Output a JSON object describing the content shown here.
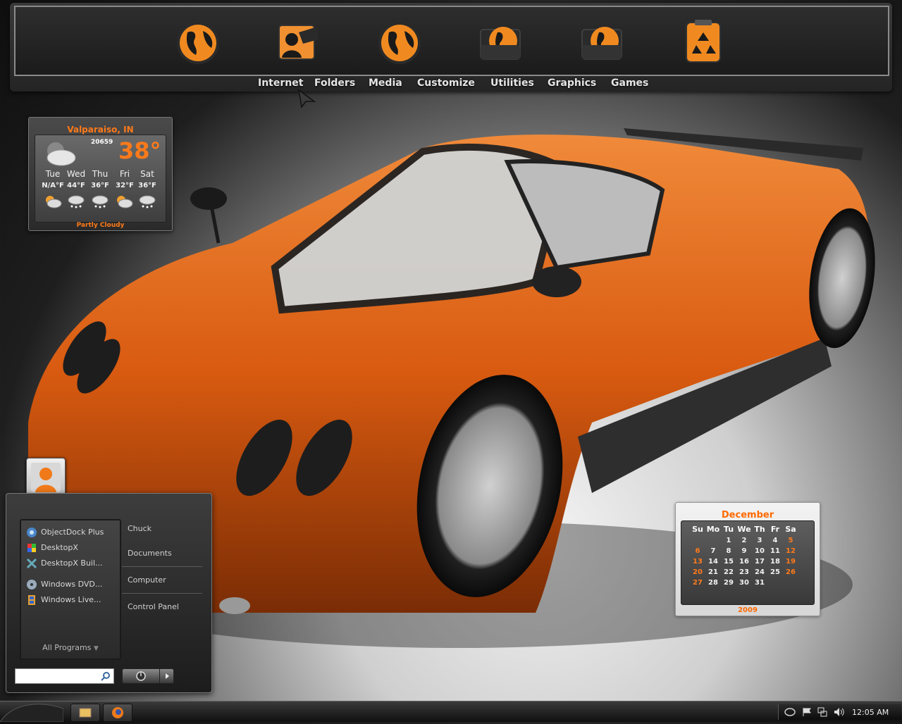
{
  "dock": {
    "icons": [
      {
        "name": "internet-globe-icon"
      },
      {
        "name": "folders-user-icon"
      },
      {
        "name": "media-globe-icon"
      },
      {
        "name": "customize-folder-icon"
      },
      {
        "name": "utilities-folder-icon"
      },
      {
        "name": "recycle-bin-icon"
      }
    ],
    "labels": [
      "Internet",
      "Folders",
      "Media",
      "Customize",
      "Utilities",
      "Graphics",
      "Games"
    ]
  },
  "weather": {
    "city": "Valparaiso, IN",
    "code": "20659",
    "temp": "38°",
    "condition": "Partly Cloudy",
    "forecast": [
      {
        "day": "Tue",
        "hi": "N/A°F"
      },
      {
        "day": "Wed",
        "hi": "44°F"
      },
      {
        "day": "Thu",
        "hi": "36°F"
      },
      {
        "day": "Fri",
        "hi": "32°F"
      },
      {
        "day": "Sat",
        "hi": "36°F"
      }
    ]
  },
  "calendar": {
    "month": "December",
    "year": "2009",
    "dow": [
      "Su",
      "Mo",
      "Tu",
      "We",
      "Th",
      "Fr",
      "Sa"
    ],
    "weeks": [
      [
        "",
        "",
        "1",
        "2",
        "3",
        "4",
        "5"
      ],
      [
        "6",
        "7",
        "8",
        "9",
        "10",
        "11",
        "12"
      ],
      [
        "13",
        "14",
        "15",
        "16",
        "17",
        "18",
        "19"
      ],
      [
        "20",
        "21",
        "22",
        "23",
        "24",
        "25",
        "26"
      ],
      [
        "27",
        "28",
        "29",
        "30",
        "31",
        "",
        ""
      ]
    ]
  },
  "start_menu": {
    "pinned": [
      {
        "label": "ObjectDock Plus",
        "icon": "objectdock-icon"
      },
      {
        "label": "DesktopX",
        "icon": "desktopx-icon"
      },
      {
        "label": "DesktopX Buil...",
        "icon": "desktopx-builder-icon"
      },
      {
        "label": "Windows DVD...",
        "icon": "dvd-maker-icon"
      },
      {
        "label": "Windows Live...",
        "icon": "movie-maker-icon"
      }
    ],
    "all_programs": "All Programs",
    "right": [
      "Chuck",
      "Documents",
      "Computer",
      "Control Panel"
    ]
  },
  "taskbar": {
    "buttons": [
      {
        "name": "explorer-folder-icon"
      },
      {
        "name": "firefox-icon"
      }
    ],
    "clock": "12:05 AM"
  },
  "colors": {
    "accent": "#ff7a1a",
    "car": "#e0661c"
  }
}
